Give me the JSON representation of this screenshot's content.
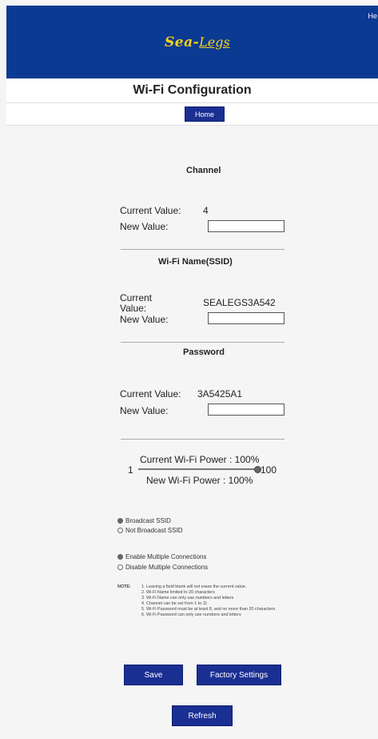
{
  "header": {
    "help_text": "He",
    "logo_sea": "Sea-",
    "logo_legs": "Legs",
    "title": "Wi-Fi Configuration"
  },
  "nav": {
    "home_label": "Home"
  },
  "channel": {
    "title": "Channel",
    "current_label": "Current Value:",
    "current_value": "4",
    "new_label": "New Value:",
    "new_value": ""
  },
  "ssid": {
    "title": "Wi-Fi Name(SSID)",
    "current_label_1": "Current",
    "current_label_2": "Value:",
    "current_value": "SEALEGS3A542",
    "new_label": "New Value:",
    "new_value": ""
  },
  "password": {
    "title": "Password",
    "current_label": "Current Value:",
    "current_value": "3A5425A1",
    "new_label": "New Value:",
    "new_value": ""
  },
  "power": {
    "current_text": "Current Wi-Fi Power : 100%",
    "new_text": "New Wi-Fi Power : 100%",
    "min_label": "1",
    "max_label": "100",
    "slider_value_percent": 100
  },
  "broadcast": {
    "option_on": "Broadcast SSID",
    "option_off": "Not Broadcast SSID",
    "selected": "Broadcast SSID"
  },
  "connections": {
    "option_on": "Enable Multiple Connections",
    "option_off": "Disable Multiple Connections",
    "selected": "Enable Multiple Connections"
  },
  "note": {
    "label": "NOTE:",
    "items": [
      "1. Leaving a field blank will not erase the current value.",
      "2. Wi-Fi Name limited to 20 characters",
      "3. Wi-Fi Name can only use numbers and letters",
      "4. Channel can be set from 1 to 11",
      "5. Wi-Fi Password must be at least 8, and no more than 20 characters",
      "6. Wi-Fi Password can only use numbers and letters"
    ]
  },
  "buttons": {
    "save": "Save",
    "factory": "Factory Settings",
    "refresh": "Refresh"
  },
  "colors": {
    "header_blue": "#0a3a92",
    "button_blue": "#1a2f92",
    "logo_yellow": "#f6d21a"
  }
}
